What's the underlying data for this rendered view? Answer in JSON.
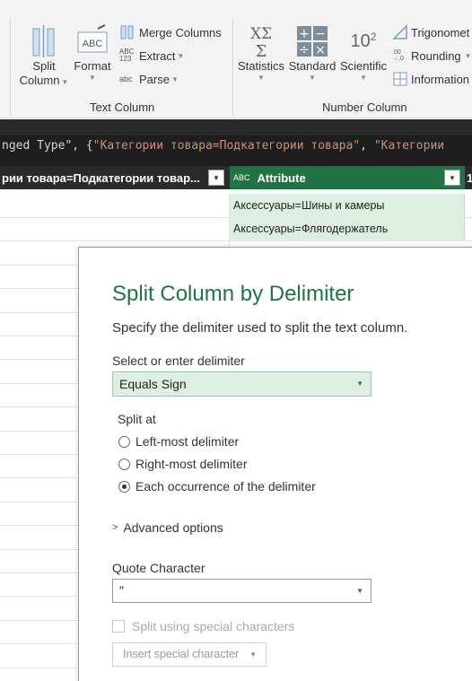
{
  "ribbon": {
    "text_column_group": {
      "label": "Text Column",
      "split_column": {
        "line1": "Split",
        "line2": "Column"
      },
      "format": {
        "label": "Format"
      },
      "merge_columns": "Merge Columns",
      "extract": "Extract",
      "parse": "Parse",
      "extract_icon": "ABC\n123",
      "parse_icon": "abc"
    },
    "number_column_group": {
      "label": "Number Column",
      "statistics": "Statistics",
      "standard": "Standard",
      "scientific": "Scientific",
      "scientific_icon_base": "10",
      "scientific_icon_exp": "2",
      "trigonometry": "Trigonomet",
      "rounding": "Rounding",
      "information": "Information",
      "rounding_icon": ".00\n→.0"
    }
  },
  "formula": {
    "prefix": "nged Type\", {",
    "string1": "\"Категории товара=Подкатегории товара\"",
    "sep": ", ",
    "string2": "\"Категории"
  },
  "grid": {
    "header_left": "рии товара=Подкатегории товар...",
    "header_attr": "Attribute",
    "header_attr_type_icon": "ABC",
    "header_next": "1",
    "rows": [
      "Аксессуары=Шины и камеры",
      "Аксессуары=Флягодержатель"
    ]
  },
  "dialog": {
    "title": "Split Column by Delimiter",
    "description": "Specify the delimiter used to split the text column.",
    "delimiter_label": "Select or enter delimiter",
    "delimiter_value": "Equals Sign",
    "split_at_label": "Split at",
    "split_options": [
      {
        "label": "Left-most delimiter",
        "selected": false
      },
      {
        "label": "Right-most delimiter",
        "selected": false
      },
      {
        "label": "Each occurrence of the delimiter",
        "selected": true
      }
    ],
    "advanced_options": "Advanced options",
    "quote_label": "Quote Character",
    "quote_value": "\"",
    "special_chars_label": "Split using special characters",
    "insert_special": "Insert special character"
  },
  "colors": {
    "accent": "#217346",
    "cell_highlight": "#dcefe1",
    "formula_bg": "#1e1e1e",
    "header_bg": "#2b2b2b",
    "formula_string": "#ce9178"
  }
}
